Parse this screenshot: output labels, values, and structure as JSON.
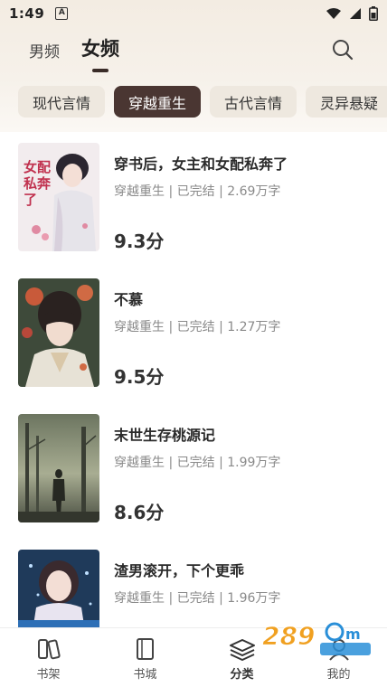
{
  "status_bar": {
    "time": "1:49",
    "indicator": "A"
  },
  "header": {
    "tabs": [
      {
        "label": "男频"
      },
      {
        "label": "女频"
      }
    ],
    "active_tab": "女频"
  },
  "categories": [
    "现代言情",
    "穿越重生",
    "古代言情",
    "灵异悬疑"
  ],
  "active_category": "穿越重生",
  "books": [
    {
      "title": "穿书后，女主和女配私奔了",
      "meta": "穿越重生 | 已完结 | 2.69万字",
      "score": "9.3分",
      "cover_text": "女配私奔了"
    },
    {
      "title": "不慕",
      "meta": "穿越重生 | 已完结 | 1.27万字",
      "score": "9.5分"
    },
    {
      "title": "末世生存桃源记",
      "meta": "穿越重生 | 已完结 | 1.99万字",
      "score": "8.6分"
    },
    {
      "title": "渣男滚开，下个更乖",
      "meta": "穿越重生 | 已完结 | 1.96万字",
      "score": ""
    }
  ],
  "bottom_nav": [
    {
      "label": "书架",
      "icon": "bookshelf-icon"
    },
    {
      "label": "书城",
      "icon": "book-icon"
    },
    {
      "label": "分类",
      "icon": "category-icon"
    },
    {
      "label": "我的",
      "icon": "profile-icon"
    }
  ],
  "active_nav": "分类",
  "colors": {
    "accent": "#4a3632",
    "header_bg": "#f3ece2",
    "chip_bg": "#eee8df"
  }
}
